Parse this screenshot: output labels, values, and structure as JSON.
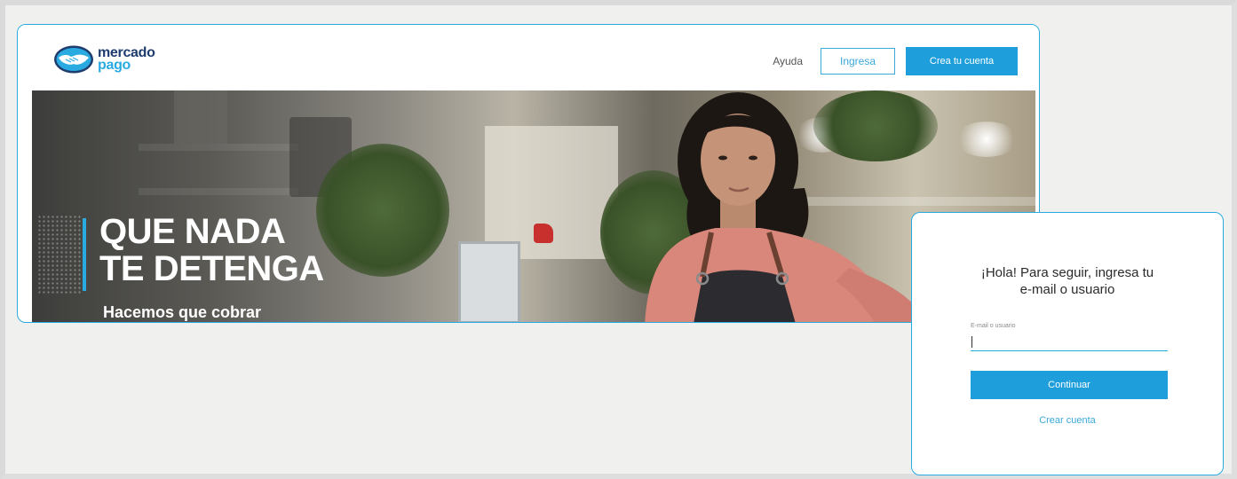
{
  "header": {
    "logo": {
      "line1": "mercado",
      "line2": "pago"
    },
    "help_label": "Ayuda",
    "login_label": "Ingresa",
    "register_label": "Crea tu cuenta"
  },
  "hero": {
    "headline_line1": "QUE NADA",
    "headline_line2": "TE DETENGA",
    "subline": "Hacemos que cobrar"
  },
  "login": {
    "title_line1": "¡Hola! Para seguir, ingresa tu",
    "title_line2": "e-mail o usuario",
    "field_label": "E-mail o usuario",
    "field_value": "",
    "continue_label": "Continuar",
    "create_account_label": "Crear cuenta"
  },
  "colors": {
    "brand_blue": "#29abe2",
    "brand_navy": "#1e3c6e",
    "button_blue": "#1e9fdc"
  },
  "icons": {
    "logo": "handshake-icon"
  }
}
